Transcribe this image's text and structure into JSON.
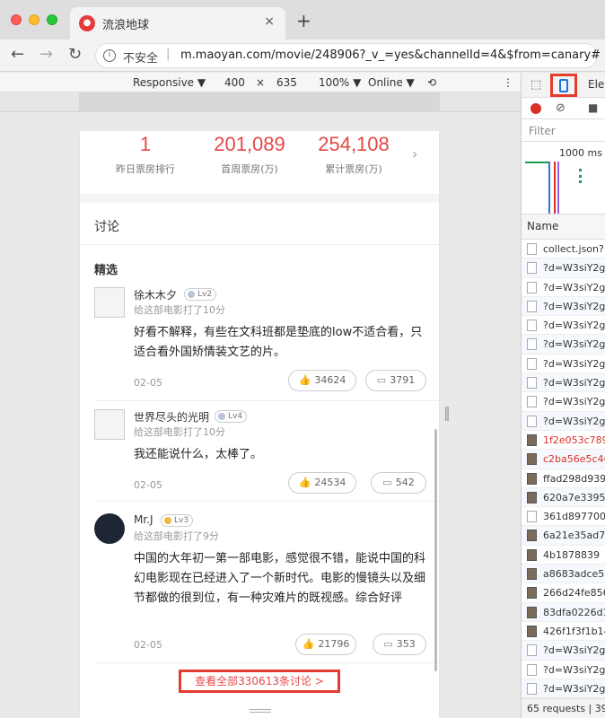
{
  "browser": {
    "tab_title": "流浪地球",
    "tab_close": "×",
    "new_tab": "+",
    "insecure_label": "不安全",
    "url_separator": "|",
    "url": "m.maoyan.com/movie/248906?_v_=yes&channelId=4&$from=canary#"
  },
  "device_toolbar": {
    "mode": "Responsive ▼",
    "width": "400",
    "times": "×",
    "height": "635",
    "zoom": "100% ▼",
    "network": "Online ▼"
  },
  "stats": [
    {
      "value": "1",
      "label": "昨日票房排行"
    },
    {
      "value": "201,089",
      "label": "首周票房(万)"
    },
    {
      "value": "254,108",
      "label": "累计票房(万)"
    }
  ],
  "section_title": "讨论",
  "subsection_title": "精选",
  "comments": [
    {
      "user": "徐木木夕",
      "level": "Lv2",
      "rated": "给这部电影打了10分",
      "text": "好看不解释，有些在文科班都是垫底的low不适合看，只适合看外国矫情装文艺的片。",
      "date": "02-05",
      "likes": "34624",
      "replies": "3791"
    },
    {
      "user": "世界尽头的光明",
      "level": "Lv4",
      "rated": "给这部电影打了10分",
      "text": "我还能说什么，太棒了。",
      "date": "02-05",
      "likes": "24534",
      "replies": "542"
    },
    {
      "user": "Mr.J",
      "level": "Lv3",
      "rated": "给这部电影打了9分",
      "text": "中国的大年初一第一部电影，感觉很不错，能说中国的科幻电影现在已经进入了一个新时代。电影的慢镜头以及细节都做的很到位，有一种灾难片的既视感。综合好评",
      "date": "02-05",
      "likes": "21796",
      "replies": "353"
    }
  ],
  "footer_link": "查看全部330613条讨论 >",
  "devtools": {
    "tab_partial": "Ele",
    "filter_placeholder": "Filter",
    "overview_time": "1000 ms",
    "name_header": "Name",
    "requests": [
      {
        "name": "collect.json?",
        "type": "doc",
        "error": false
      },
      {
        "name": "?d=W3siY2g",
        "type": "doc",
        "error": false
      },
      {
        "name": "?d=W3siY2g",
        "type": "doc",
        "error": false
      },
      {
        "name": "?d=W3siY2g",
        "type": "doc",
        "error": false
      },
      {
        "name": "?d=W3siY2g",
        "type": "doc",
        "error": false
      },
      {
        "name": "?d=W3siY2g",
        "type": "doc",
        "error": false
      },
      {
        "name": "?d=W3siY2g",
        "type": "doc",
        "error": false
      },
      {
        "name": "?d=W3siY2g",
        "type": "doc",
        "error": false
      },
      {
        "name": "?d=W3siY2g",
        "type": "doc",
        "error": false
      },
      {
        "name": "?d=W3siY2g",
        "type": "doc",
        "error": false
      },
      {
        "name": "1f2e053c789",
        "type": "img",
        "error": true
      },
      {
        "name": "c2ba56e5c46",
        "type": "img",
        "error": true
      },
      {
        "name": "ffad298d939",
        "type": "img",
        "error": false
      },
      {
        "name": "620a7e33958",
        "type": "img",
        "error": false
      },
      {
        "name": "361d897700",
        "type": "doc",
        "error": false
      },
      {
        "name": "6a21e35ad7",
        "type": "img",
        "error": false
      },
      {
        "name": "4b1878839",
        "type": "img",
        "error": false
      },
      {
        "name": "a8683adce5",
        "type": "img",
        "error": false
      },
      {
        "name": "266d24fe856",
        "type": "img",
        "error": false
      },
      {
        "name": "83dfa0226d1",
        "type": "img",
        "error": false
      },
      {
        "name": "426f1f3f1b14",
        "type": "img",
        "error": false
      },
      {
        "name": "?d=W3siY2g",
        "type": "doc",
        "error": false
      },
      {
        "name": "?d=W3siY2g",
        "type": "doc",
        "error": false
      },
      {
        "name": "?d=W3siY2g",
        "type": "doc",
        "error": false
      }
    ],
    "status": "65 requests | 39"
  },
  "colors": {
    "accent": "#e54847",
    "highlight_box": "#e43c2e",
    "device_icon": "#1a73e8"
  }
}
